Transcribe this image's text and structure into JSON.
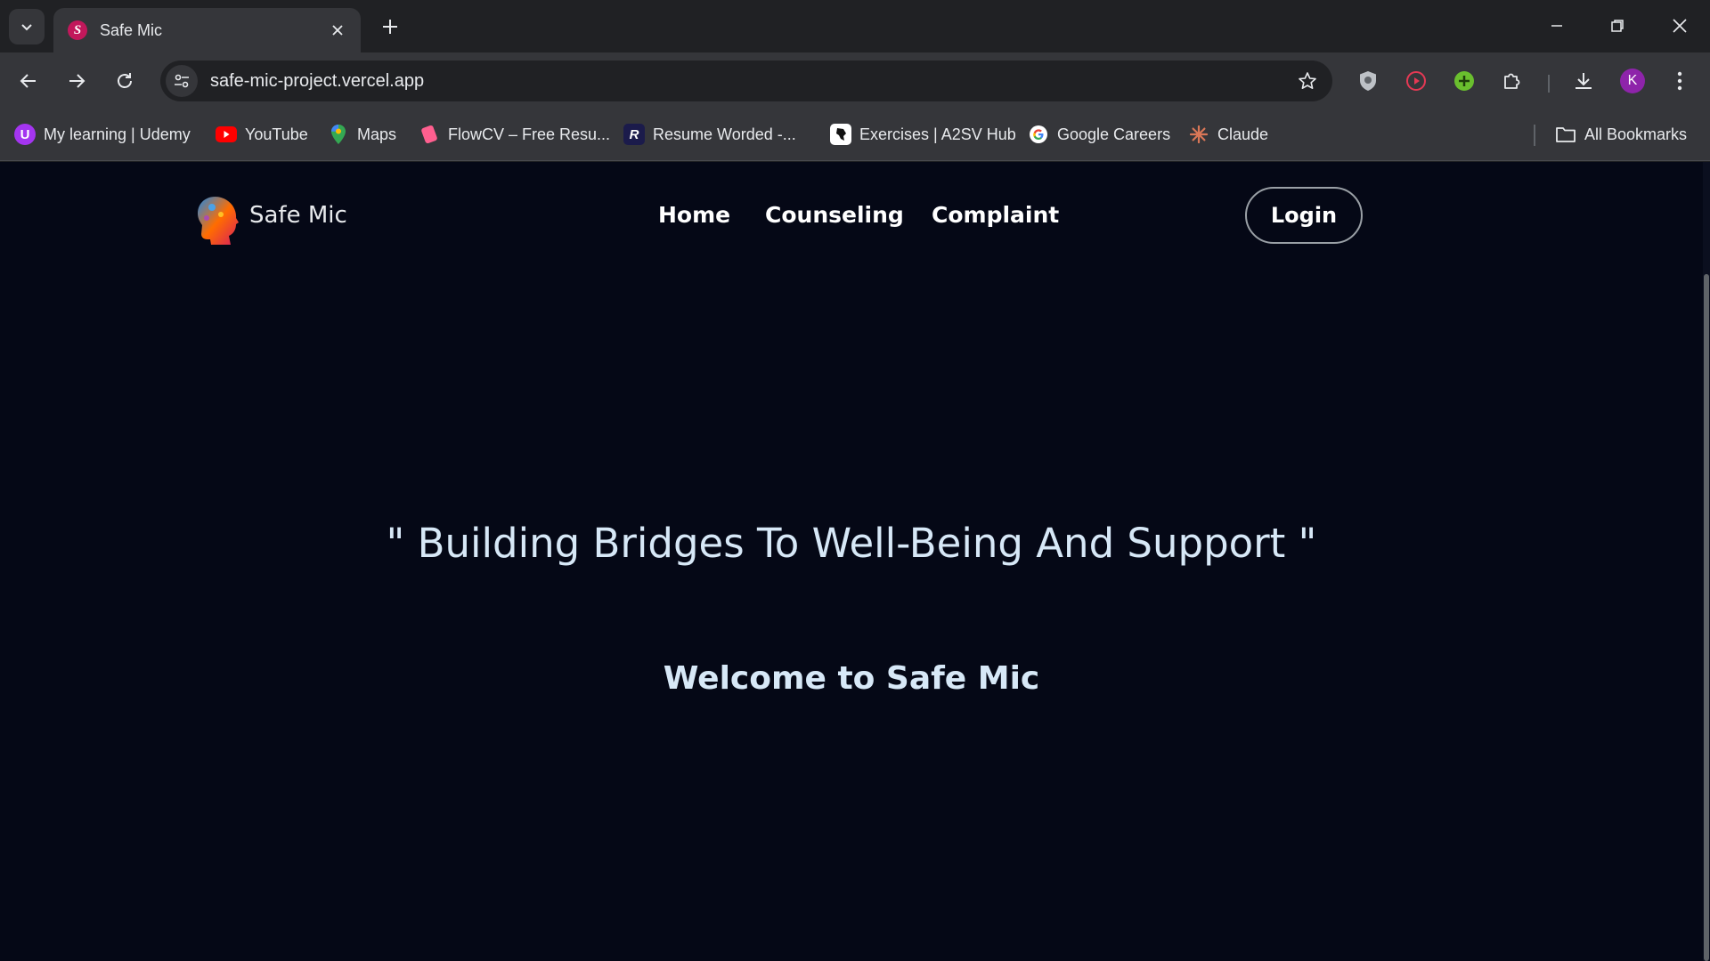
{
  "browser": {
    "tab": {
      "title": "Safe Mic",
      "favicon_letter": "S",
      "favicon_color": "#c2185b"
    },
    "address": {
      "url": "safe-mic-project.vercel.app"
    },
    "profile_initial": "K",
    "profile_color": "#8e24aa"
  },
  "bookmarks": [
    {
      "label": "My learning | Udemy",
      "icon": "udemy-icon"
    },
    {
      "label": "YouTube",
      "icon": "youtube-icon"
    },
    {
      "label": "Maps",
      "icon": "maps-icon"
    },
    {
      "label": "FlowCV – Free Resu...",
      "icon": "flowcv-icon"
    },
    {
      "label": "Resume Worded -...",
      "icon": "resume-worded-icon"
    },
    {
      "label": "Exercises | A2SV Hub",
      "icon": "a2sv-icon"
    },
    {
      "label": "Google Careers",
      "icon": "google-icon"
    },
    {
      "label": "Claude",
      "icon": "claude-icon"
    }
  ],
  "all_bookmarks_label": "All Bookmarks",
  "site": {
    "name": "Safe Mic",
    "nav": [
      "Home",
      "Counseling",
      "Complaint"
    ],
    "login_label": "Login",
    "tagline": "\" Building Bridges To Well-Being And Support \"",
    "welcome": "Welcome to Safe Mic"
  },
  "colors": {
    "page_background": "#050816",
    "heading_text": "#d7e8f7",
    "browser_frame": "#35363a"
  }
}
